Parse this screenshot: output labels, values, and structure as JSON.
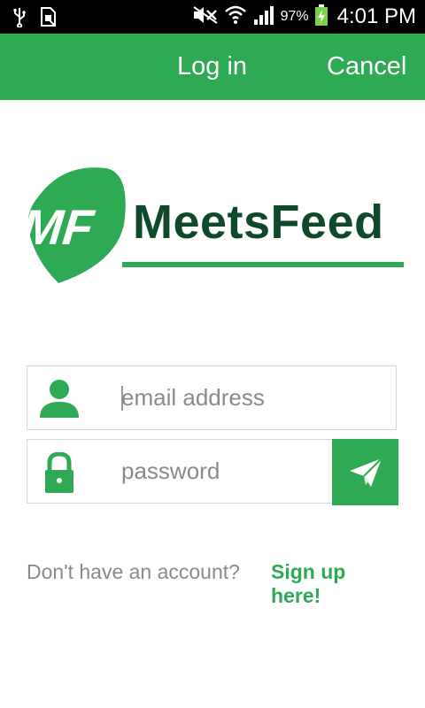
{
  "status_bar": {
    "battery": "97%",
    "time": "4:01 PM",
    "icons": [
      "usb-icon",
      "sim-icon",
      "mute-icon",
      "wifi-icon",
      "signal-icon",
      "battery-charging-icon"
    ]
  },
  "action_bar": {
    "login_label": "Log in",
    "cancel_label": "Cancel"
  },
  "logo": {
    "monogram": "MF",
    "brand_name": "MeetsFeed"
  },
  "login_form": {
    "email_placeholder": "email address",
    "email_value": "",
    "password_placeholder": "password",
    "password_value": "",
    "email_icon": "user-icon",
    "password_icon": "lock-icon",
    "submit_icon": "paper-plane-icon"
  },
  "signup": {
    "prompt": "Don't have an account?",
    "link": "Sign up here!"
  },
  "colors": {
    "accent": "#2eaa55",
    "brand_text": "#0e4a2a"
  }
}
